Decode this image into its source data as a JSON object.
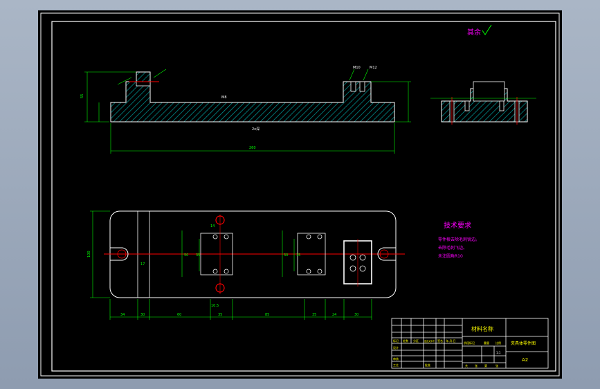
{
  "colors": {
    "paper": "#000000",
    "frame": "#ffffff",
    "dim": "#00ff00",
    "centerline": "#ff0000",
    "hatch": "#00a0a0",
    "note_text": "#ff00ff",
    "title_text": "#ffff00"
  },
  "drawing": {
    "surface_note": "其余",
    "front_view": {
      "overall_length": "260",
      "height": "55",
      "notes": [
        "M8",
        "2x深",
        "M10",
        "M12"
      ]
    },
    "plan_view": {
      "width_label": "100",
      "bottom_dims": [
        "34",
        "30",
        "60",
        "35",
        "85",
        "35",
        "24",
        "30"
      ],
      "vertical_dims": [
        "14",
        "50",
        "35",
        "30",
        "15"
      ],
      "misc_dims": [
        "17",
        "10.5"
      ]
    },
    "tech_requirements": {
      "title": "技术要求",
      "items": [
        "零件棱去除毛刺锐边。",
        "去除毛刺飞边。",
        "未注圆角R10"
      ]
    }
  },
  "title_block": {
    "material_header": "材料名称",
    "drawing_name": "夹具体零件图",
    "sheet_size": "A2",
    "scale": "1:1",
    "row_labels": [
      "标记",
      "设计",
      "审核",
      "工艺"
    ],
    "col_labels": [
      "处数",
      "分区",
      "更改文件号",
      "签名",
      "年.月.日"
    ],
    "stage_labels": [
      "阶段标记",
      "重量",
      "比例"
    ],
    "bottom_labels": [
      "共",
      "张",
      "第",
      "张"
    ],
    "approve_label": "批准"
  }
}
